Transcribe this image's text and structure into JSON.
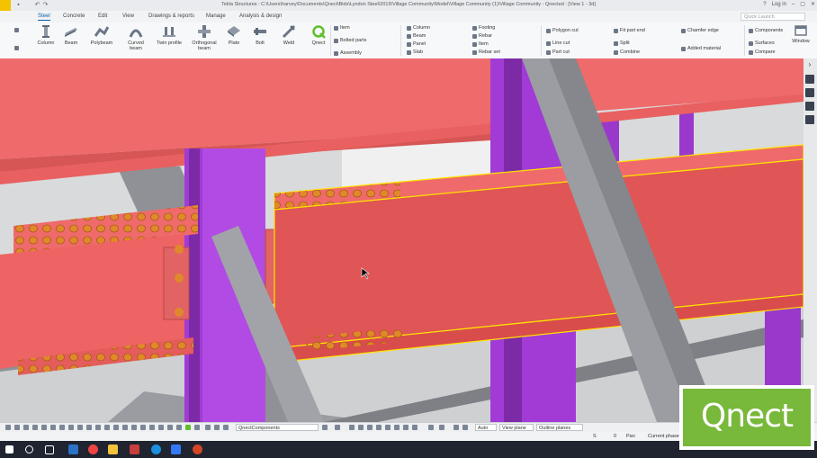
{
  "window": {
    "title": "Tekla Structures : C:\\Users\\harvey\\Documents\\Qnect\\Bids\\Lyndon Steel\\2019\\Village Community\\Model\\Village Community (1)\\Village Community - Qnected : [View 1 - 3d]",
    "help": "?",
    "login": "Log in"
  },
  "tabs": [
    "Steel",
    "Concrete",
    "Edit",
    "View",
    "Drawings & reports",
    "Manage",
    "Analysis & design"
  ],
  "active_tab": "Steel",
  "search": {
    "placeholder": "Quick Launch"
  },
  "ribbon": {
    "big_tools": [
      {
        "label": "Column",
        "icon": "column-icon"
      },
      {
        "label": "Beam",
        "icon": "beam-icon"
      },
      {
        "label": "Polybeam",
        "icon": "polybeam-icon"
      },
      {
        "label": "Curved beam",
        "icon": "curved-beam-icon"
      },
      {
        "label": "Twin profile",
        "icon": "twin-profile-icon"
      },
      {
        "label": "Orthogonal beam",
        "icon": "orthogonal-beam-icon"
      },
      {
        "label": "Plate",
        "icon": "plate-icon"
      },
      {
        "label": "Bolt",
        "icon": "bolt-icon"
      },
      {
        "label": "Weld",
        "icon": "weld-icon"
      },
      {
        "label": "Qnect",
        "icon": "qnect-icon"
      }
    ],
    "group1": [
      "Item",
      "Bolted parts",
      "Assembly"
    ],
    "group2": [
      "Column",
      "Beam",
      "Panel",
      "Slab"
    ],
    "group3": [
      "Footing",
      "Rebar",
      "Item",
      "Rebar set"
    ],
    "group4": [
      "Polygon cut",
      "Line cut",
      "Part cut"
    ],
    "group5": [
      "Fit part end",
      "Split",
      "Combine"
    ],
    "group6": [
      "Chamfer edge",
      "Added material"
    ],
    "group7": [
      "Components",
      "Surfaces",
      "Compare"
    ],
    "window_label": "Window"
  },
  "bottombar": {
    "component_select": "QnectComponents",
    "auto": "Auto",
    "view_plane": "View plane",
    "outline_planes": "Outline planes"
  },
  "statusbar": {
    "s": "S",
    "zero": "0",
    "pan": "Pan",
    "phase": "Current phase"
  },
  "logo": {
    "text": "Qnect"
  },
  "colors": {
    "beam_red": "#ef6a6a",
    "column_purple": "#a23bd6",
    "brace_grey": "#8f9196",
    "bolt_orange": "#e0892a",
    "selection_yellow": "#ffe400",
    "logo_green": "#78b83a"
  }
}
